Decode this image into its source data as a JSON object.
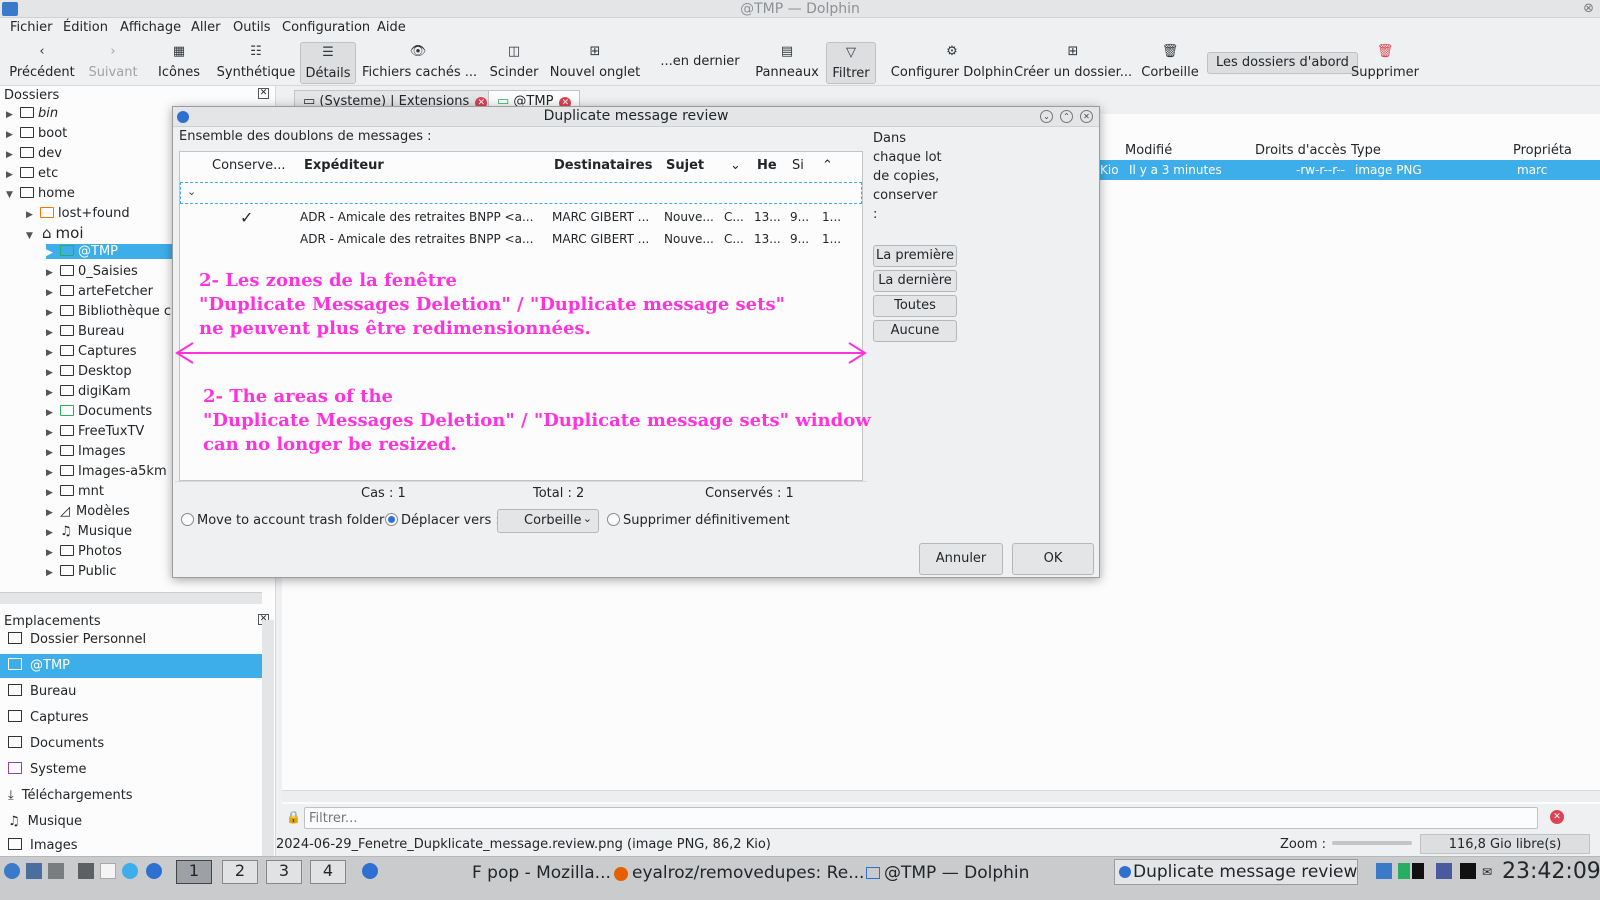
{
  "window": {
    "title": "@TMP — Dolphin"
  },
  "menu": [
    "Fichier",
    "Édition",
    "Affichage",
    "Aller",
    "Outils",
    "Configuration",
    "Aide"
  ],
  "toolbar": {
    "back": "Précédent",
    "forward": "Suivant",
    "icons": "Icônes",
    "compact": "Synthétique",
    "details": "Détails",
    "hidden": "Fichiers cachés ...",
    "split": "Scinder",
    "new_tab": "Nouvel onglet",
    "last": "...en dernier",
    "panels": "Panneaux",
    "filter": "Filtrer",
    "configure": "Configurer Dolphin",
    "new_folder": "Créer un dossier...",
    "trash": "Corbeille",
    "folders_first": "Les dossiers d'abord",
    "delete": "Supprimer"
  },
  "folders_panel": {
    "title": "Dossiers",
    "items": [
      "bin",
      "boot",
      "dev",
      "etc",
      "home",
      "lost+found",
      "moi",
      "@TMP",
      "0_Saisies",
      "arteFetcher",
      "Bibliothèque ca",
      "Bureau",
      "Captures",
      "Desktop",
      "digiKam",
      "Documents",
      "FreeTuxTV",
      "Images",
      "Images-a5km",
      "mnt",
      "Modèles",
      "Musique",
      "Photos",
      "Public"
    ]
  },
  "places_panel": {
    "title": "Emplacements",
    "items": [
      "Dossier Personnel",
      "@TMP",
      "Bureau",
      "Captures",
      "Documents",
      "Systeme",
      "Téléchargements",
      "Musique",
      "Images"
    ]
  },
  "tabs": [
    "(Systeme) | Extensions",
    "@TMP"
  ],
  "file_view": {
    "columns": [
      "Modifié",
      "Droits d'accès",
      "Type",
      "Propriéta"
    ],
    "row": {
      "size": "Kio",
      "modified": "Il y a 3 minutes",
      "perms": "-rw-r--r--",
      "type": "image PNG",
      "owner": "marc"
    }
  },
  "filter": {
    "placeholder": "Filtrer..."
  },
  "status": {
    "file": "2024-06-29_Fenetre_Dupklicate_message.review.png (image PNG, 86,2 Kio)",
    "zoom": "Zoom :",
    "free": "116,8 Gio libre(s)"
  },
  "dialog": {
    "title": "Duplicate message review",
    "sets_label": "Ensemble des doublons de messages :",
    "columns": [
      "Conserve...",
      "Expéditeur",
      "Destinataires",
      "Sujet",
      "He",
      "Si"
    ],
    "rows": [
      {
        "keep": "✓",
        "from": "ADR - Amicale des retraites BNPP <a...",
        "to": "MARC GIBERT ...",
        "subject": "Nouve...",
        "c": "C...",
        "date": "13...",
        "size": "9...",
        "x": "1..."
      },
      {
        "keep": "",
        "from": "ADR - Amicale des retraites BNPP <a...",
        "to": "MARC GIBERT ...",
        "subject": "Nouve...",
        "c": "C...",
        "date": "13...",
        "size": "9...",
        "x": "1..."
      }
    ],
    "keep_label": "Dans chaque lot de copies, conserver :",
    "buttons": {
      "first": "La première",
      "last": "La dernière",
      "all": "Toutes",
      "none": "Aucune",
      "cancel": "Annuler",
      "ok": "OK"
    },
    "summary": {
      "cases": "Cas : 1",
      "total": "Total : 2",
      "kept": "Conservés : 1"
    },
    "actions": {
      "move_trash": "Move to account trash folder",
      "move_to": "Déplacer vers :",
      "folder": "Corbeille",
      "delete": "Supprimer définitivement"
    },
    "annotation_fr": [
      "2- Les zones de la fenêtre",
      "\"Duplicate Messages Deletion\" / \"Duplicate message sets\"",
      "ne peuvent plus être redimensionnées."
    ],
    "annotation_en": [
      "2- The areas of the",
      "\"Duplicate Messages Deletion\" / \"Duplicate message sets\" window",
      "can no longer be resized."
    ]
  },
  "taskbar": {
    "desktops": [
      "1",
      "2",
      "3",
      "4"
    ],
    "tasks": [
      "F pop - Mozilla...",
      "eyalroz/removedupes: Re...",
      "@TMP — Dolphin",
      "Duplicate message review"
    ],
    "clock": "23:42:09"
  },
  "colors": {
    "selection": "#3daee9",
    "annotation": "#ff33dd",
    "close": "#da4453"
  }
}
